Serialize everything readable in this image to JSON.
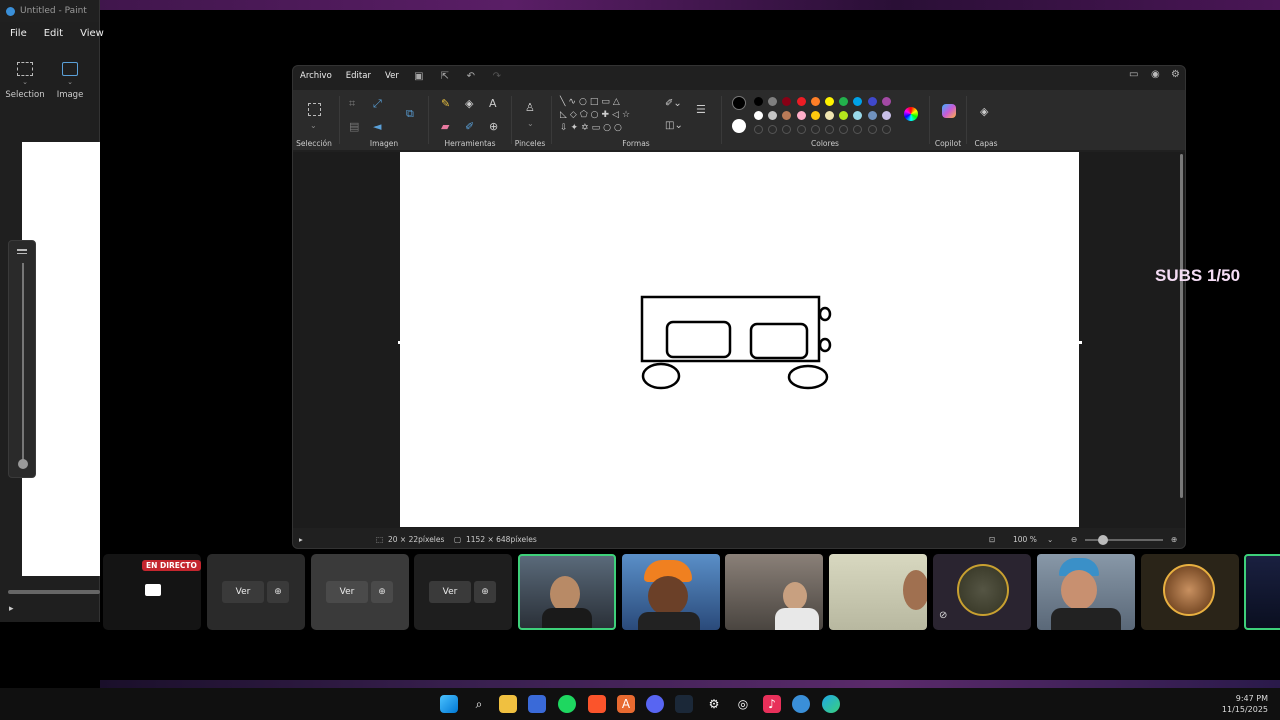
{
  "old_window": {
    "title": "Untitled - Paint",
    "menu": [
      "File",
      "Edit",
      "View"
    ],
    "tools": [
      {
        "label": "Selection",
        "icon": "selection-icon"
      },
      {
        "label": "Image",
        "icon": "image-icon"
      }
    ]
  },
  "paint": {
    "menu": [
      "Archivo",
      "Editar",
      "Ver"
    ],
    "ribbon_groups": [
      "Selección",
      "Imagen",
      "Herramientas",
      "Pinceles",
      "Formas",
      "Colores",
      "Copilot",
      "Capas"
    ],
    "colors_row1": [
      "#000000",
      "#7f7f7f",
      "#880015",
      "#ed1c24",
      "#ff7f27",
      "#fff200",
      "#22b14c",
      "#00a2e8",
      "#3f48cc",
      "#a349a4"
    ],
    "colors_row2": [
      "#ffffff",
      "#c3c3c3",
      "#b97a57",
      "#ffaec9",
      "#ffc90e",
      "#efe4b0",
      "#b5e61d",
      "#99d9ea",
      "#7092be",
      "#c8bfe7"
    ],
    "status": {
      "selection_size": "20 × 22píxeles",
      "canvas_size": "1152 × 648píxeles",
      "zoom": "100 %"
    }
  },
  "overlay": {
    "subs": "SUBS 1/50"
  },
  "strip": {
    "live_badge": "EN DIRECTO",
    "view_label": "Ver"
  },
  "clock": {
    "time": "9:47 PM",
    "date": "11/15/2025"
  }
}
